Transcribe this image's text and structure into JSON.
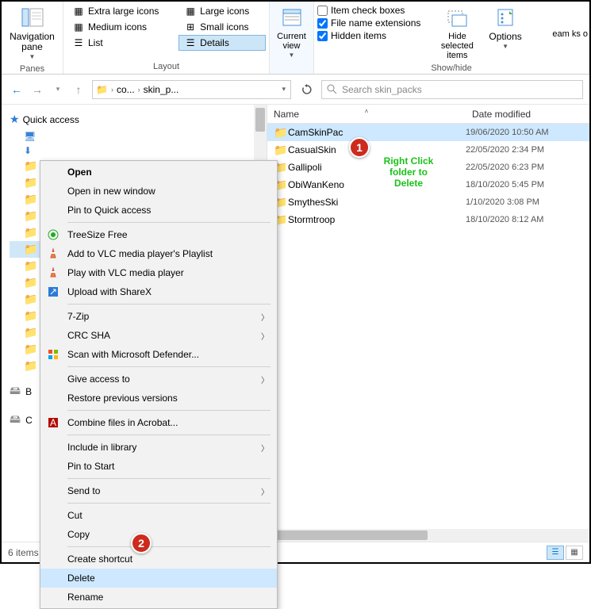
{
  "ribbon": {
    "panes": {
      "nav_label": "Navigation pane",
      "group_label": "Panes"
    },
    "layout": {
      "group_label": "Layout",
      "items": [
        {
          "label": "Extra large icons",
          "selected": false
        },
        {
          "label": "Large icons",
          "selected": false
        },
        {
          "label": "Medium icons",
          "selected": false
        },
        {
          "label": "Small icons",
          "selected": false
        },
        {
          "label": "List",
          "selected": false
        },
        {
          "label": "Details",
          "selected": true
        }
      ]
    },
    "current_view_label": "Current view",
    "show_hide": {
      "group_label": "Show/hide",
      "item_checkboxes": {
        "label": "Item check boxes",
        "checked": false
      },
      "file_ext": {
        "label": "File name extensions",
        "checked": true
      },
      "hidden": {
        "label": "Hidden items",
        "checked": true
      },
      "hide_selected_label": "Hide selected items"
    },
    "options_label": "Options"
  },
  "nav": {
    "breadcrumb": [
      "co...",
      "skin_p..."
    ],
    "search_placeholder": "Search skin_packs"
  },
  "tree": {
    "quick_access": "Quick access",
    "b_label": "B",
    "c_label": "C"
  },
  "columns": {
    "name": "Name",
    "date": "Date modified"
  },
  "files": [
    {
      "name": "CamSkinPac",
      "date": "19/06/2020 10:50 AM",
      "selected": true
    },
    {
      "name": "CasualSkin",
      "date": "22/05/2020 2:34 PM",
      "selected": false
    },
    {
      "name": "Gallipoli",
      "date": "22/05/2020 6:23 PM",
      "selected": false
    },
    {
      "name": "ObiWanKeno",
      "date": "18/10/2020 5:45 PM",
      "selected": false
    },
    {
      "name": "SmythesSki",
      "date": "1/10/2020 3:08 PM",
      "selected": false
    },
    {
      "name": "Stormtroop",
      "date": "18/10/2020 8:12 AM",
      "selected": false
    }
  ],
  "status": {
    "items": "6 items"
  },
  "context_menu": [
    {
      "label": "Open",
      "bold": true
    },
    {
      "label": "Open in new window"
    },
    {
      "label": "Pin to Quick access"
    },
    {
      "sep": true
    },
    {
      "label": "TreeSize Free",
      "icon": "treesize"
    },
    {
      "label": "Add to VLC media player's Playlist",
      "icon": "vlc"
    },
    {
      "label": "Play with VLC media player",
      "icon": "vlc"
    },
    {
      "label": "Upload with ShareX",
      "icon": "sharex"
    },
    {
      "sep": true
    },
    {
      "label": "7-Zip",
      "submenu": true
    },
    {
      "label": "CRC SHA",
      "submenu": true
    },
    {
      "label": "Scan with Microsoft Defender...",
      "icon": "defender"
    },
    {
      "sep": true
    },
    {
      "label": "Give access to",
      "submenu": true
    },
    {
      "label": "Restore previous versions"
    },
    {
      "sep": true
    },
    {
      "label": "Combine files in Acrobat...",
      "icon": "acrobat"
    },
    {
      "sep": true
    },
    {
      "label": "Include in library",
      "submenu": true
    },
    {
      "label": "Pin to Start"
    },
    {
      "sep": true
    },
    {
      "label": "Send to",
      "submenu": true
    },
    {
      "sep": true
    },
    {
      "label": "Cut"
    },
    {
      "label": "Copy"
    },
    {
      "sep": true
    },
    {
      "label": "Create shortcut"
    },
    {
      "label": "Delete",
      "hover": true
    },
    {
      "label": "Rename"
    }
  ],
  "annotation": {
    "b1": "1",
    "b2": "2",
    "overlay_l1": "Right Click",
    "overlay_l2": "folder to",
    "overlay_l3": "Delete"
  },
  "truncated_right": "eam ks o"
}
